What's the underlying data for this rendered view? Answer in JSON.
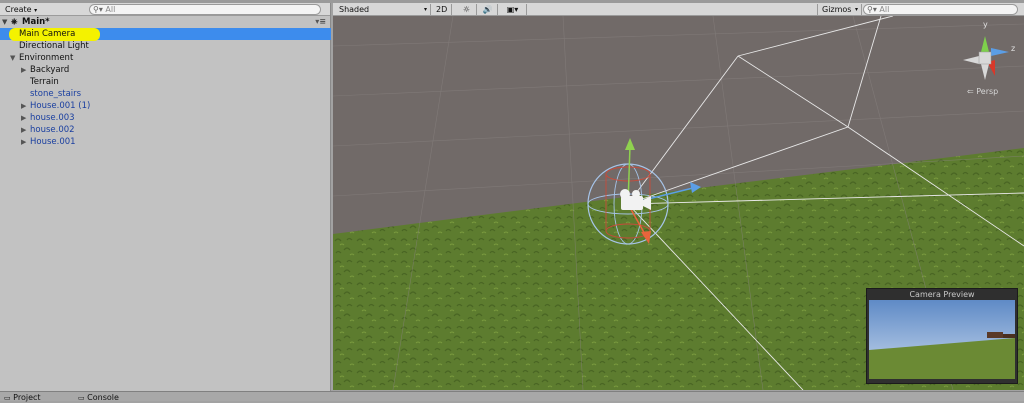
{
  "hierarchy": {
    "create_label": "Create",
    "search_placeholder": "All",
    "scene_name": "Main*",
    "items": [
      {
        "label": "Main Camera"
      },
      {
        "label": "Directional Light"
      },
      {
        "label": "Environment"
      },
      {
        "label": "Backyard"
      },
      {
        "label": "Terrain"
      },
      {
        "label": "stone_stairs"
      },
      {
        "label": "House.001 (1)"
      },
      {
        "label": "house.003"
      },
      {
        "label": "house.002"
      },
      {
        "label": "House.001"
      }
    ]
  },
  "scene": {
    "shading_mode": "Shaded",
    "mode_2d": "2D",
    "gizmos_label": "Gizmos",
    "search_placeholder": "All",
    "persp_label": "Persp",
    "axis_y": "y",
    "axis_z": "z",
    "camera_preview_title": "Camera Preview"
  },
  "bottom_tabs": {
    "project": "Project",
    "console": "Console"
  },
  "colors": {
    "selection": "#3d8ced",
    "highlight": "#f4f200",
    "prefab_text": "#1a3fa0",
    "grass": "#5b7a2e",
    "sky_gray": "#716a68"
  }
}
